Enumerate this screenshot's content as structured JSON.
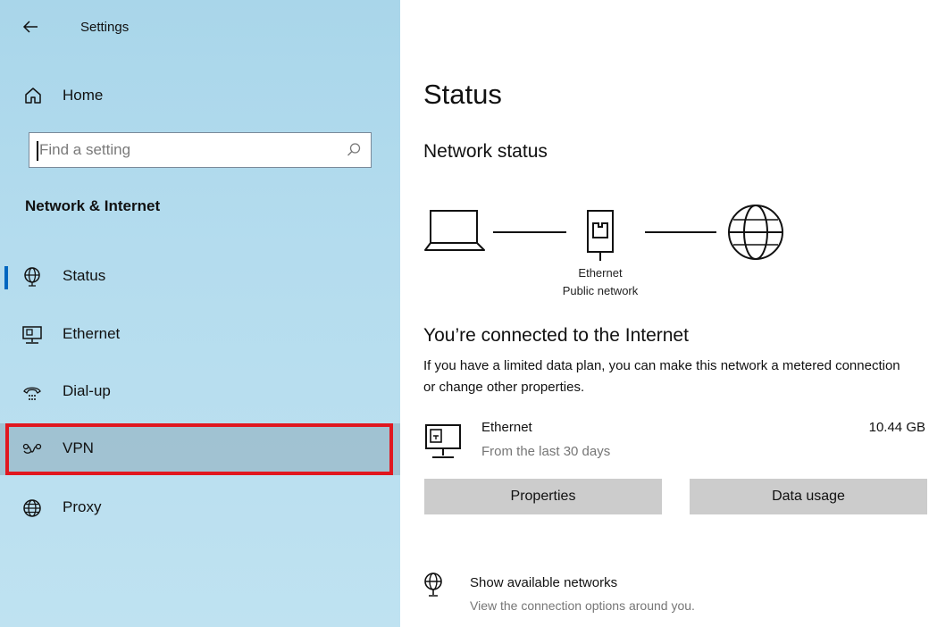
{
  "titlebar": {
    "title": "Settings",
    "back_icon": "back-arrow-icon"
  },
  "sidebar": {
    "home_label": "Home",
    "search": {
      "placeholder": "Find a setting",
      "value": ""
    },
    "section_title": "Network & Internet",
    "items": [
      {
        "label": "Status",
        "icon": "globe-status-icon",
        "selected": true
      },
      {
        "label": "Ethernet",
        "icon": "ethernet-icon",
        "selected": false
      },
      {
        "label": "Dial-up",
        "icon": "dialup-icon",
        "selected": false
      },
      {
        "label": "VPN",
        "icon": "vpn-icon",
        "selected": false,
        "highlighted": true
      },
      {
        "label": "Proxy",
        "icon": "globe-icon",
        "selected": false
      }
    ]
  },
  "main": {
    "title": "Status",
    "network_status": {
      "heading": "Network status",
      "connection_type": "Ethernet",
      "network_profile": "Public network"
    },
    "connection": {
      "title": "You’re connected to the Internet",
      "description": "If you have a limited data plan, you can make this network a metered connection or change other properties."
    },
    "adapter": {
      "name": "Ethernet",
      "subtitle": "From the last 30 days",
      "usage": "10.44 GB"
    },
    "buttons": {
      "properties": "Properties",
      "data_usage": "Data usage"
    },
    "available": {
      "title": "Show available networks",
      "description": "View the connection options around you."
    }
  },
  "colors": {
    "accent": "#0067c0",
    "highlight": "#e0171f",
    "sidebar_bg": "#b4dcee",
    "button_bg": "#cccccc"
  }
}
